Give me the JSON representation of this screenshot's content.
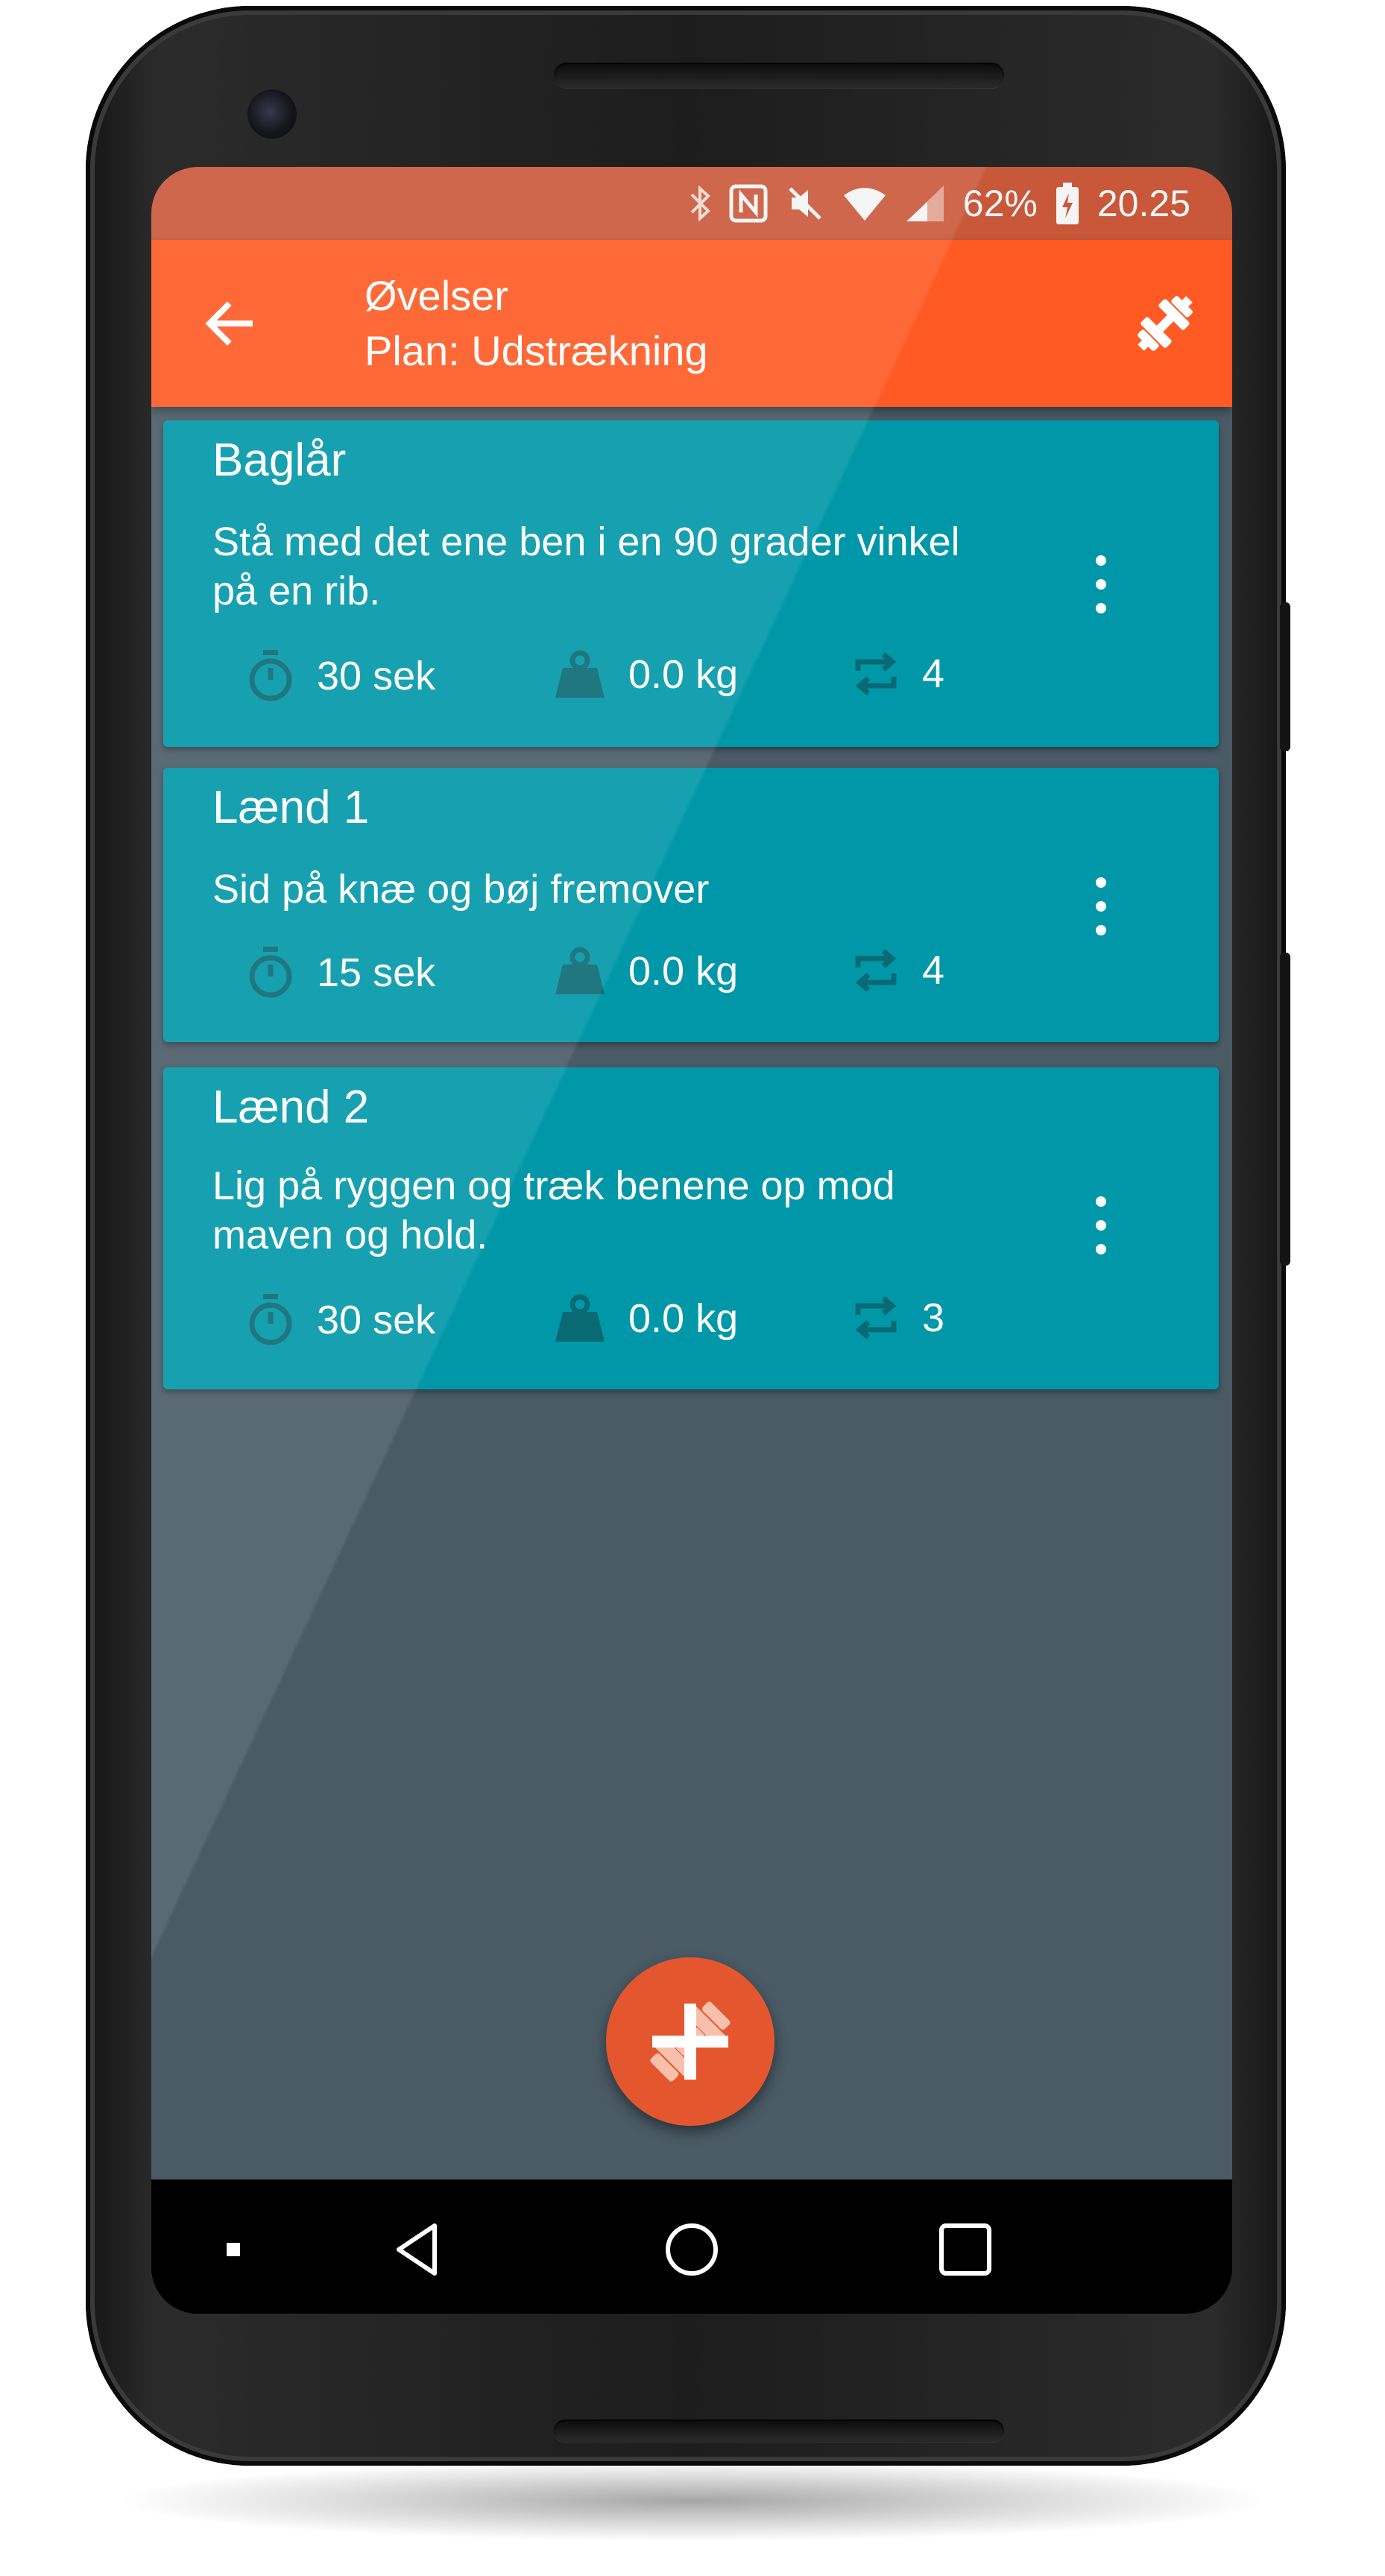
{
  "status_bar": {
    "battery": "62%",
    "time": "20.25",
    "icons": [
      "bluetooth-icon",
      "nfc-icon",
      "mute-icon",
      "wifi-icon",
      "signal-icon",
      "battery-charging-icon"
    ]
  },
  "app_bar": {
    "title": "Øvelser",
    "subtitle": "Plan: Udstrækning",
    "back_icon": "arrow-left-icon",
    "action_icon": "dumbbell-icon"
  },
  "exercises": [
    {
      "name": "Baglår",
      "description": "Stå med det ene ben i en 90 grader vinkel på en rib.",
      "duration": "30 sek",
      "weight": "0.0 kg",
      "repetitions": "4"
    },
    {
      "name": "Lænd 1",
      "description": "Sid på knæ og bøj fremover",
      "duration": "15 sek",
      "weight": "0.0 kg",
      "repetitions": "4"
    },
    {
      "name": "Lænd 2",
      "description": "Lig på ryggen og træk benene op mod maven og hold.",
      "duration": "30 sek",
      "weight": "0.0 kg",
      "repetitions": "3"
    }
  ],
  "fab": {
    "icon": "add-exercise-icon"
  },
  "nav_bar": {
    "buttons": [
      "dot-icon",
      "back-triangle-icon",
      "home-circle-icon",
      "recents-square-icon"
    ]
  },
  "colors": {
    "status_bar": "#c9583a",
    "app_bar": "#ff5a24",
    "card": "#0098a8",
    "background": "#4a5b66",
    "fab": "#e4572e",
    "stat_icon": "#0a6a74"
  }
}
